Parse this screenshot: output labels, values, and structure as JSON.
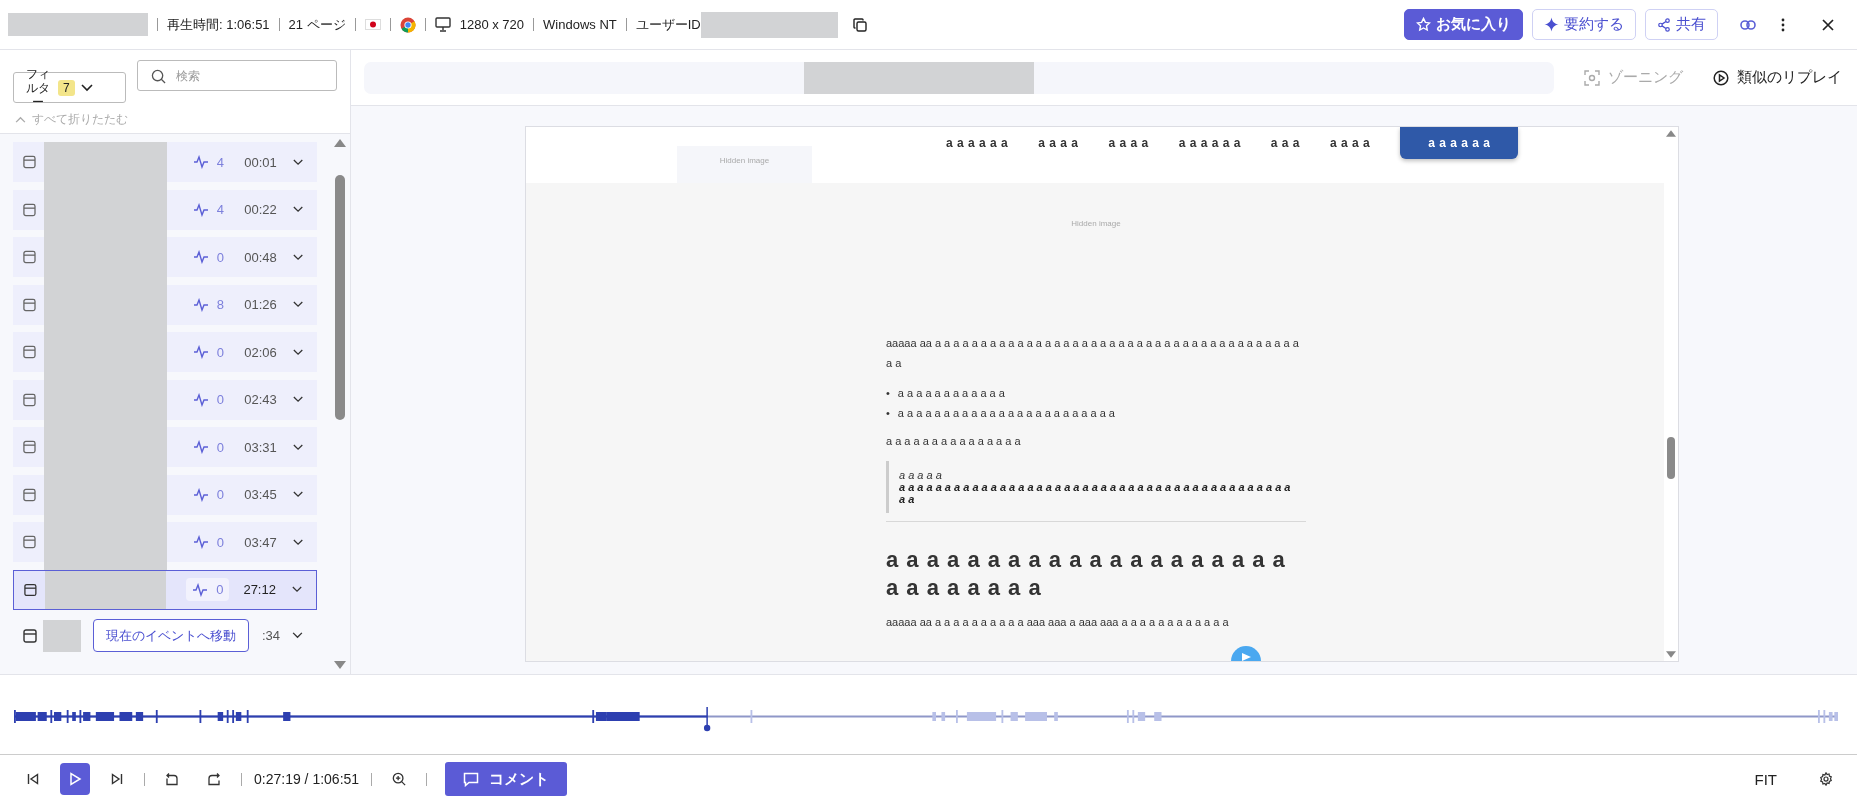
{
  "header": {
    "duration": "再生時間: 1:06:51",
    "pages": "21 ページ",
    "resolution": "1280 x 720",
    "os": "Windows NT",
    "user_id_label": "ユーザーID"
  },
  "actions": [
    {
      "label": "お気に入り",
      "kind": "favorite",
      "primary": true
    },
    {
      "label": "要約する",
      "kind": "summarize",
      "primary": false
    },
    {
      "label": "共有",
      "kind": "share",
      "primary": false
    }
  ],
  "filter": {
    "label": "フィルター",
    "count": "7"
  },
  "search": {
    "placeholder": "検索"
  },
  "collapse_all": "すべて折りたたむ",
  "events": [
    {
      "count": "4",
      "time": "00:01",
      "selected": false
    },
    {
      "count": "4",
      "time": "00:22",
      "selected": false
    },
    {
      "count": "0",
      "time": "00:48",
      "selected": false
    },
    {
      "count": "8",
      "time": "01:26",
      "selected": false
    },
    {
      "count": "0",
      "time": "02:06",
      "selected": false
    },
    {
      "count": "0",
      "time": "02:43",
      "selected": false
    },
    {
      "count": "0",
      "time": "03:31",
      "selected": false
    },
    {
      "count": "0",
      "time": "03:45",
      "selected": false
    },
    {
      "count": "0",
      "time": "03:47",
      "selected": false
    },
    {
      "count": "0",
      "time": "27:12",
      "selected": true
    }
  ],
  "jump_row": {
    "time": ":34",
    "button": "現在のイベントへ移動"
  },
  "toolbar": {
    "zoning": {
      "label": "ゾーニング",
      "disabled": true
    },
    "similar": "類似のリプレイ"
  },
  "page": {
    "nav": [
      {
        "label": "a a a a a a",
        "selected": false
      },
      {
        "label": "a a a a",
        "selected": false
      },
      {
        "label": "a a a a",
        "selected": false
      },
      {
        "label": "a a a a a a",
        "selected": false
      },
      {
        "label": "a a a",
        "selected": false
      },
      {
        "label": "a a a a",
        "selected": false
      },
      {
        "label": "a a a a a a",
        "selected": true
      }
    ],
    "logo_image": "Hidden image",
    "hero_image": "Hidden image",
    "blocks": [
      {
        "kind": "paragraph",
        "text": "aaaaa aa a a a a a a  a a a a a a a a a a a a a a a a a a a a a a a a a a a a a a a a a a a a"
      },
      {
        "kind": "list",
        "items": [
          {
            "marker": "•",
            "text": "a a a a a a a a a a a a"
          },
          {
            "marker": "•",
            "text": "a a a a a a a a a a a a a a a a a a a a a a a a"
          }
        ]
      },
      {
        "kind": "paragraph",
        "text": "a a a a a a a a a a a a a a a"
      },
      {
        "kind": "quote",
        "caption": "a a a a a",
        "text": "a a a a a a a a a a a a a a a a a a a a a a a a a a a a a a a a a a a a a a a a a a a a a"
      },
      {
        "kind": "heading",
        "text": "a a a a a a a a a a a a a a a a a a a a a a a a a a a a"
      },
      {
        "kind": "paragraph",
        "text": "aaaaa aa a a a a a a a a a a aaa aaa a aaa aaa a a a a a a a a a a a a"
      }
    ]
  },
  "timeline": {
    "level": 0.38
  },
  "player": {
    "time": "0:27:19 / 1:06:51",
    "comment": "コメント",
    "fit": "FIT"
  }
}
